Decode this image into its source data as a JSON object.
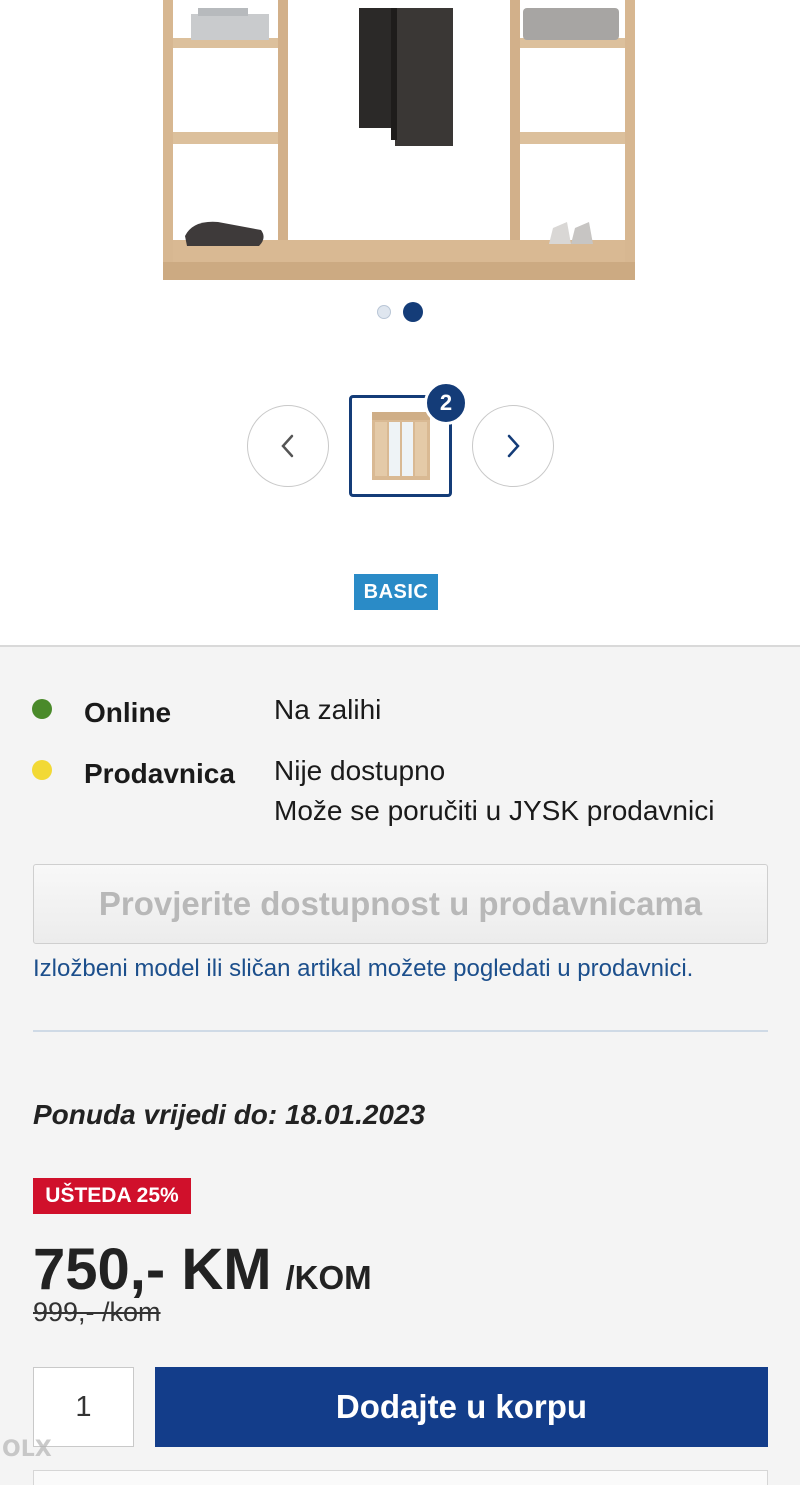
{
  "gallery": {
    "active_slide": 2,
    "total_slides": 2,
    "thumbnail_count_badge": "2"
  },
  "brand_badge": "BASIC",
  "availability": {
    "online": {
      "label": "Online",
      "status": "Na zalihi",
      "dot_color": "#4a8a2a"
    },
    "store": {
      "label": "Prodavnica",
      "status": "Nije dostupno",
      "status_sub": "Može se poručiti u JYSK prodavnici",
      "dot_color": "#f2d935"
    }
  },
  "check_button_label": "Provjerite dostupnost u prodavnicama",
  "showroom_note": "Izložbeni model ili sličan artikal možete pogledati u prodavnici.",
  "offer_valid": "Ponuda vrijedi do: 18.01.2023",
  "discount_badge": "UŠTEDA 25%",
  "price": {
    "current": "750,- KM",
    "unit": "/KOM",
    "old": "999,- /kom"
  },
  "cart": {
    "quantity": "1",
    "add_label": "Dodajte u korpu"
  },
  "watermark": "OLX",
  "colors": {
    "primary": "#133d8a",
    "badge_blue": "#2a8bc7",
    "sale_red": "#d0102b"
  }
}
